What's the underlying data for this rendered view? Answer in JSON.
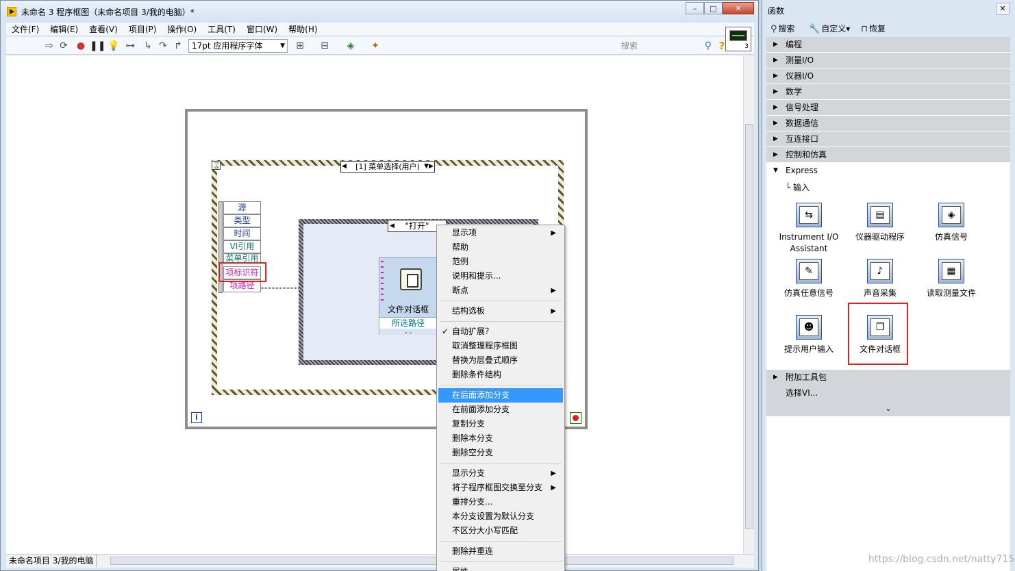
{
  "window": {
    "title": "未命名 3 程序框图（未命名项目 3/我的电脑）*",
    "minimize": "–",
    "maximize": "□",
    "close": "✕"
  },
  "menu": [
    "文件(F)",
    "编辑(E)",
    "查看(V)",
    "项目(P)",
    "操作(O)",
    "工具(T)",
    "窗口(W)",
    "帮助(H)"
  ],
  "toolbar": {
    "font": "17pt 应用程序字体",
    "search_placeholder": "搜索",
    "icons": [
      "run-arrow-icon",
      "run-continuous-icon",
      "abort-icon",
      "pause-icon",
      "highlight-execution-icon",
      "retain-wire-values-icon",
      "step-into-icon",
      "step-over-icon",
      "step-out-icon",
      "align-icon",
      "distribute-icon",
      "reorder-icon",
      "cleanup-icon"
    ],
    "vi_icon_number": "3"
  },
  "diagram": {
    "event_case": "[1] 菜单选择(用户)",
    "case_value": "\"打开\"",
    "event_terminals": [
      "源",
      "类型",
      "时间",
      "VI引用",
      "菜单引用",
      "项标识符",
      "项路径"
    ],
    "node_label": "文件对话框",
    "node_terminal": "所选路径",
    "info_term": "i"
  },
  "context_menu": {
    "items": [
      {
        "label": "显示项",
        "sub": true
      },
      {
        "label": "帮助"
      },
      {
        "label": "范例"
      },
      {
        "label": "说明和提示..."
      },
      {
        "label": "断点",
        "sub": true
      },
      {
        "sep": true
      },
      {
        "label": "结构选板",
        "sub": true
      },
      {
        "sep": true
      },
      {
        "label": "自动扩展？",
        "checked": true
      },
      {
        "label": "取消整理程序框图"
      },
      {
        "label": "替换为层叠式顺序"
      },
      {
        "label": "删除条件结构"
      },
      {
        "sep": true
      },
      {
        "label": "在后面添加分支",
        "highlighted": true
      },
      {
        "label": "在前面添加分支"
      },
      {
        "label": "复制分支"
      },
      {
        "label": "删除本分支"
      },
      {
        "label": "删除空分支"
      },
      {
        "sep": true
      },
      {
        "label": "显示分支",
        "sub": true
      },
      {
        "label": "将子程序框图交换至分支",
        "sub": true
      },
      {
        "label": "重排分支..."
      },
      {
        "label": "本分支设置为默认分支"
      },
      {
        "label": "不区分大小写匹配"
      },
      {
        "sep": true
      },
      {
        "label": "删除并重连"
      },
      {
        "sep": true
      },
      {
        "label": "属性"
      }
    ]
  },
  "palette": {
    "title": "函数",
    "close": "✕",
    "search": "搜索",
    "customize": "自定义▾",
    "restore": "恢复",
    "categories": [
      "编程",
      "测量I/O",
      "仪器I/O",
      "数学",
      "信号处理",
      "数据通信",
      "互连接口",
      "控制和仿真"
    ],
    "express": "Express",
    "express_sub": "└ 输入",
    "tiles": [
      {
        "label": "Instrument I/O Assistant",
        "glyph": "⇆"
      },
      {
        "label": "仪器驱动程序",
        "glyph": "▤"
      },
      {
        "label": "仿真信号",
        "glyph": "◈"
      },
      {
        "label": "仿真任意信号",
        "glyph": "✎"
      },
      {
        "label": "声音采集",
        "glyph": "♪"
      },
      {
        "label": "读取测量文件",
        "glyph": "▦"
      },
      {
        "label": "提示用户输入",
        "glyph": "☻"
      },
      {
        "label": "文件对话框",
        "glyph": "❐"
      }
    ],
    "addons": "附加工具包",
    "select_vi": "选择VI...",
    "more": "≫"
  },
  "status": {
    "project": "未命名项目 3/我的电脑"
  },
  "watermark": "https://blog.csdn.net/natty715"
}
